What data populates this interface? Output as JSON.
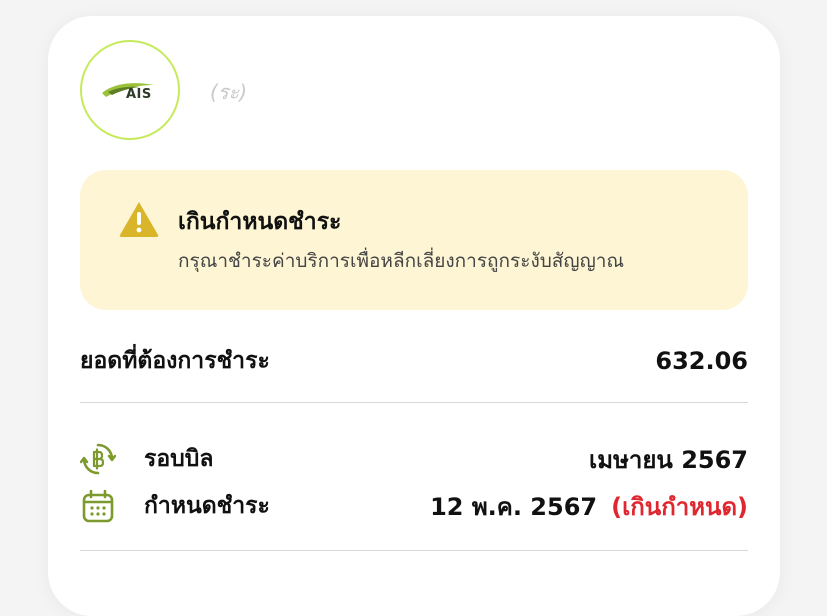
{
  "provider": {
    "logo_text": "AIS",
    "account_label": "(ระ)"
  },
  "alert": {
    "icon": "warning-icon",
    "title": "เกินกำหนดชำระ",
    "message": "กรุณาชำระค่าบริการเพื่อหลีกเลี่ยงการถูกระงับสัญญาณ",
    "background": "#fdf5d3",
    "icon_color": "#d9b52a"
  },
  "amount": {
    "label": "ยอดที่ต้องการชำระ",
    "value": "632.06"
  },
  "billing": [
    {
      "icon": "baht-cycle-icon",
      "label": "รอบบิล",
      "value": "เมษายน 2567"
    },
    {
      "icon": "calendar-icon",
      "label": "กำหนดชำระ",
      "value": "12 พ.ค. 2567",
      "status": "(เกินกำหนด)"
    }
  ],
  "colors": {
    "accent_green": "#7d9a2e",
    "logo_ring": "#c6ea5a",
    "overdue_red": "#e0262f"
  }
}
